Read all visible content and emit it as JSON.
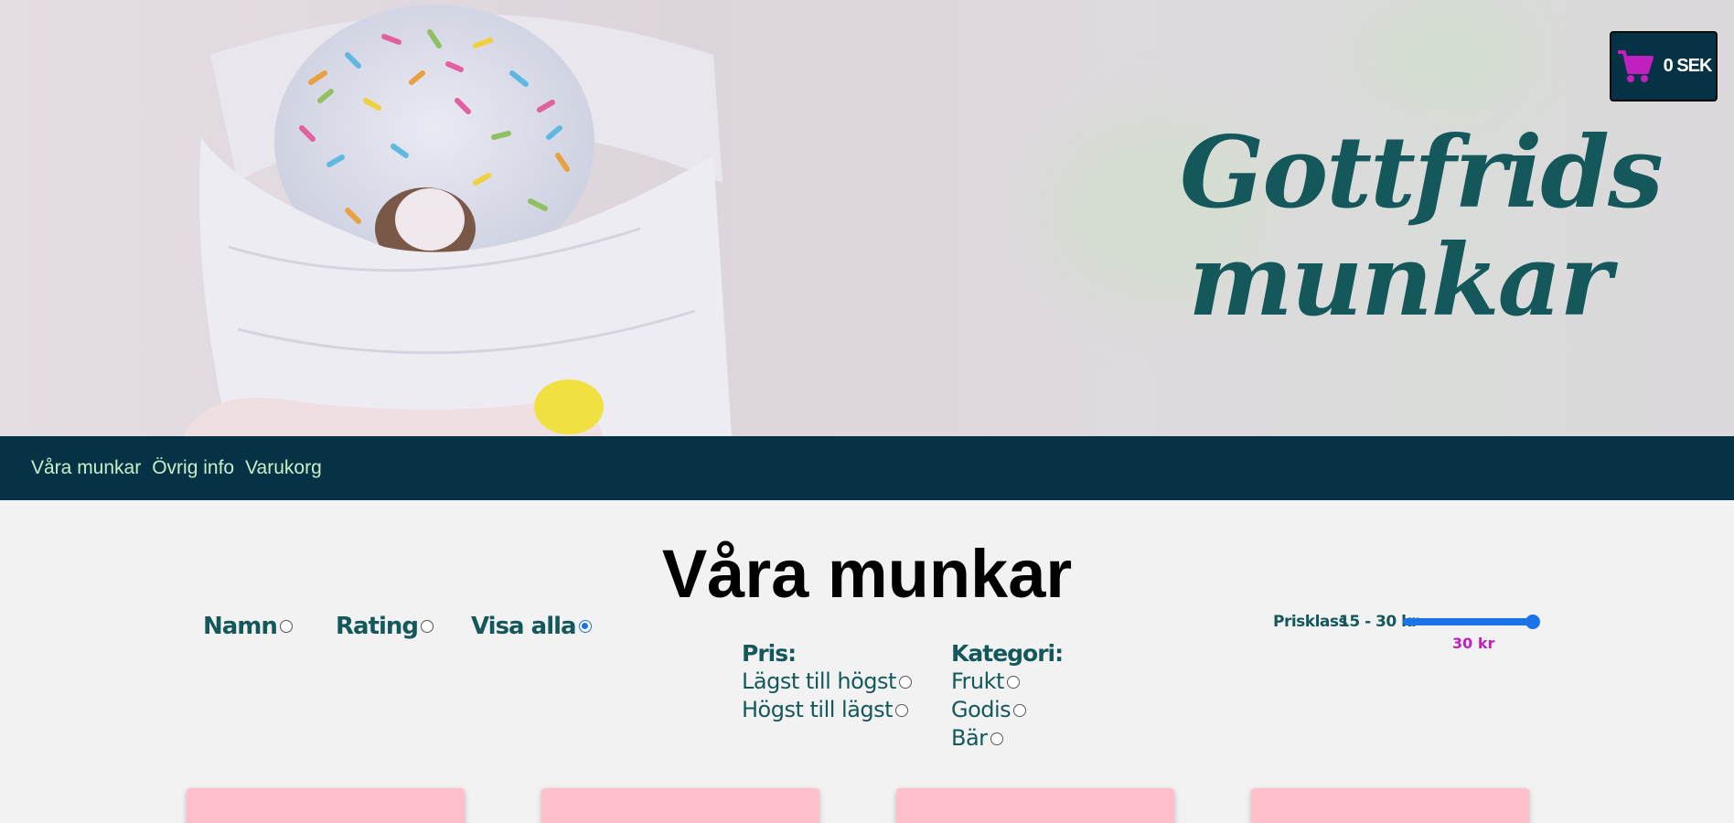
{
  "hero": {
    "title_line1": "Gottfrids",
    "title_line2": "munkar",
    "image_alt": "Donut with sprinkles in paper"
  },
  "cart": {
    "total": "0 SEK",
    "icon": "cart-icon"
  },
  "nav": {
    "items": [
      {
        "label": "Våra munkar"
      },
      {
        "label": "Övrig info"
      },
      {
        "label": "Varukorg"
      }
    ]
  },
  "main": {
    "title": "Våra munkar",
    "sort": [
      {
        "label": "Namn",
        "checked": false
      },
      {
        "label": "Rating",
        "checked": false
      },
      {
        "label": "Visa alla",
        "checked": true
      }
    ],
    "price_filter": {
      "heading": "Pris:",
      "options": [
        "Lägst till högst",
        "Högst till lägst"
      ]
    },
    "category_filter": {
      "heading": "Kategori:",
      "options": [
        "Frukt",
        "Godis",
        "Bär"
      ]
    },
    "price_range": {
      "label": "Prisklass",
      "range_text": "15 - 30 kr",
      "value_text": "30 kr",
      "min": 15,
      "max": 30,
      "value": 30
    },
    "card_count": 4
  },
  "colors": {
    "nav_bg": "#063246",
    "title": "#15585c",
    "nav_link": "#c8f0c8",
    "accent_magenta": "#c020c0",
    "card": "#ffc0cb"
  }
}
